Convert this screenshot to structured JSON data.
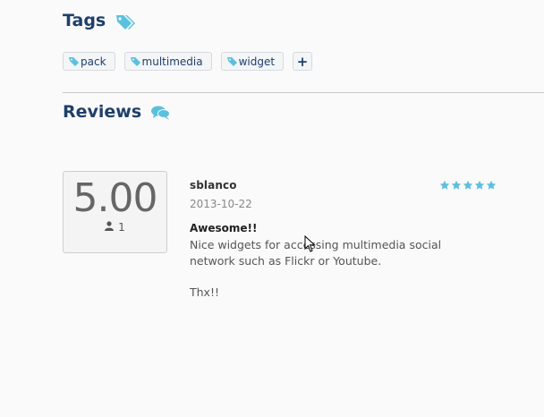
{
  "tags_section": {
    "title": "Tags",
    "tags": [
      {
        "label": "pack"
      },
      {
        "label": "multimedia"
      },
      {
        "label": "widget"
      }
    ],
    "add_label": "+"
  },
  "reviews_section": {
    "title": "Reviews",
    "score": "5.00",
    "count": "1",
    "review": {
      "author": "sblanco",
      "date": "2013-10-22",
      "title": "Awesome!!",
      "body": "Nice widgets for accessing multimedia social network such as Flickr or Youtube.",
      "signoff": "Thx!!",
      "rating": 5,
      "rating_max": 5
    }
  },
  "colors": {
    "accent": "#5bc0de",
    "heading": "#1f3f6b"
  }
}
